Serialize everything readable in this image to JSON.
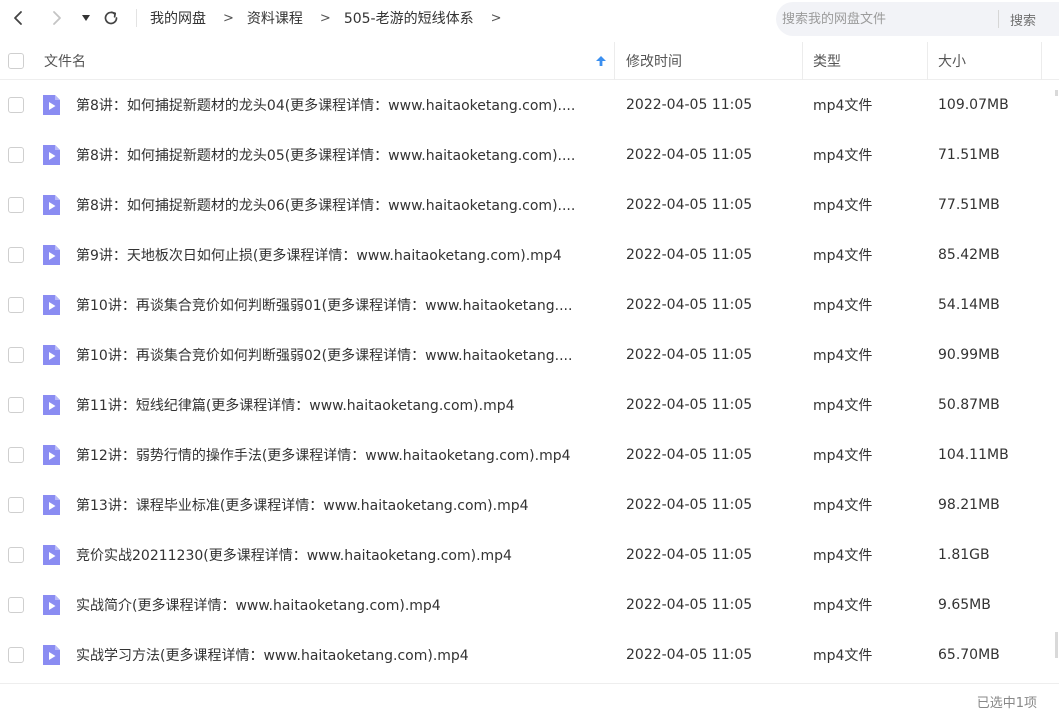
{
  "nav": {
    "back_icon": "chevron-left-icon",
    "forward_icon": "chevron-right-icon",
    "dropdown_icon": "caret-down-icon",
    "refresh_icon": "refresh-icon"
  },
  "breadcrumb": [
    "我的网盘",
    "资料课程",
    "505-老游的短线体系"
  ],
  "breadcrumb_separator": ">",
  "search": {
    "placeholder": "搜索我的网盘文件",
    "value": "",
    "button_label": "搜索"
  },
  "table": {
    "columns": {
      "name": "文件名",
      "modified": "修改时间",
      "type": "类型",
      "size": "大小"
    },
    "sort_icon": "arrow-up-icon",
    "rows": [
      {
        "name": "第8讲：如何捕捉新题材的龙头04(更多课程详情：www.haitaoketang.com)....",
        "modified": "2022-04-05 11:05",
        "type": "mp4文件",
        "size": "109.07MB"
      },
      {
        "name": "第8讲：如何捕捉新题材的龙头05(更多课程详情：www.haitaoketang.com)....",
        "modified": "2022-04-05 11:05",
        "type": "mp4文件",
        "size": "71.51MB"
      },
      {
        "name": "第8讲：如何捕捉新题材的龙头06(更多课程详情：www.haitaoketang.com)....",
        "modified": "2022-04-05 11:05",
        "type": "mp4文件",
        "size": "77.51MB"
      },
      {
        "name": "第9讲：天地板次日如何止损(更多课程详情：www.haitaoketang.com).mp4",
        "modified": "2022-04-05 11:05",
        "type": "mp4文件",
        "size": "85.42MB"
      },
      {
        "name": "第10讲：再谈集合竞价如何判断强弱01(更多课程详情：www.haitaoketang....",
        "modified": "2022-04-05 11:05",
        "type": "mp4文件",
        "size": "54.14MB"
      },
      {
        "name": "第10讲：再谈集合竞价如何判断强弱02(更多课程详情：www.haitaoketang....",
        "modified": "2022-04-05 11:05",
        "type": "mp4文件",
        "size": "90.99MB"
      },
      {
        "name": "第11讲：短线纪律篇(更多课程详情：www.haitaoketang.com).mp4",
        "modified": "2022-04-05 11:05",
        "type": "mp4文件",
        "size": "50.87MB"
      },
      {
        "name": "第12讲：弱势行情的操作手法(更多课程详情：www.haitaoketang.com).mp4",
        "modified": "2022-04-05 11:05",
        "type": "mp4文件",
        "size": "104.11MB"
      },
      {
        "name": "第13讲：课程毕业标准(更多课程详情：www.haitaoketang.com).mp4",
        "modified": "2022-04-05 11:05",
        "type": "mp4文件",
        "size": "98.21MB"
      },
      {
        "name": "竞价实战20211230(更多课程详情：www.haitaoketang.com).mp4",
        "modified": "2022-04-05 11:05",
        "type": "mp4文件",
        "size": "1.81GB"
      },
      {
        "name": "实战简介(更多课程详情：www.haitaoketang.com).mp4",
        "modified": "2022-04-05 11:05",
        "type": "mp4文件",
        "size": "9.65MB"
      },
      {
        "name": "实战学习方法(更多课程详情：www.haitaoketang.com).mp4",
        "modified": "2022-04-05 11:05",
        "type": "mp4文件",
        "size": "65.70MB"
      }
    ],
    "row_icon": "video-file-icon"
  },
  "footer": {
    "status": "已选中1项"
  },
  "colors": {
    "file_icon": "#8a8cf2",
    "sort_arrow": "#3b8ff0",
    "search_bg": "#f2f3f7"
  }
}
